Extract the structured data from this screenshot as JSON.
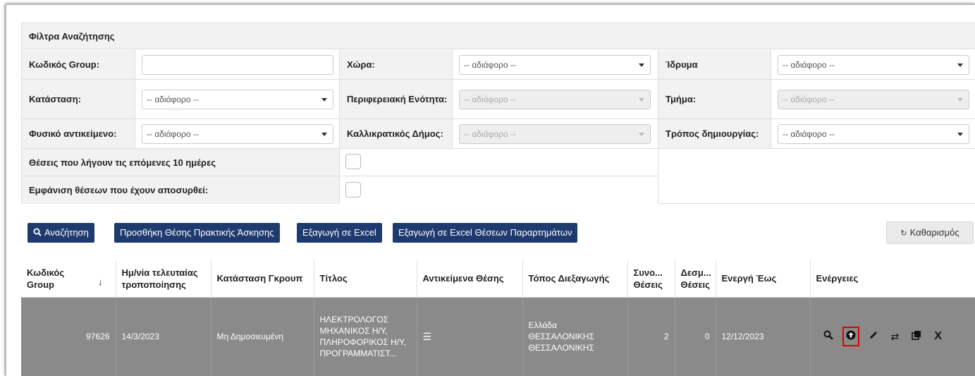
{
  "filters": {
    "title": "Φίλτρα Αναζήτησης",
    "group_code_label": "Κωδικός Group:",
    "group_code_value": "",
    "country_label": "Χώρα:",
    "country_value": "-- αδιάφορο --",
    "institution_label": "Ίδρυμα",
    "institution_value": "-- αδιάφορο --",
    "status_label": "Κατάσταση:",
    "status_value": "-- αδιάφορο --",
    "region_label": "Περιφερειακή Ενότητα:",
    "region_value": "-- αδιάφορο --",
    "department_label": "Τμήμα:",
    "department_value": "-- αδιάφορο --",
    "physical_object_label": "Φυσικό αντικείμενο:",
    "physical_object_value": "-- αδιάφορο --",
    "municipality_label": "Καλλικρατικός Δήμος:",
    "municipality_value": "-- αδιάφορο --",
    "creation_mode_label": "Τρόπος δημιουργίας:",
    "creation_mode_value": "-- αδιάφορο --",
    "expiring_label": "Θέσεις που λήγουν τις επόμενες 10 ημέρες",
    "withdrawn_label": "Εμφάνιση θέσεων που έχουν αποσυρθεί:"
  },
  "buttons": {
    "search": "Αναζήτηση",
    "add_position": "Προσθήκη Θέσης Πρακτικής Άσκησης",
    "export_excel": "Εξαγωγή σε Excel",
    "export_excel_branches": "Εξαγωγή σε Excel Θέσεων Παραρτημάτων",
    "clear": "Καθαρισμός"
  },
  "table": {
    "headers": {
      "group_code": "Κωδικός Group",
      "last_modified": "Ημ/νία τελευταίας τροποποίησης",
      "group_status": "Κατάσταση Γκρουπ",
      "title": "Τίτλος",
      "objects": "Αντικείμενα Θέσης",
      "location": "Τόπος Διεξαγωγής",
      "total_positions": "Συνο... Θέσεις",
      "bound_positions": "Δεσμ... Θέσεις",
      "active_until": "Ενεργή Έως",
      "actions": "Ενέργειες"
    },
    "rows": [
      {
        "group_code": "97626",
        "last_modified": "14/3/2023",
        "group_status": "Μη Δημοσιευμένη",
        "title": "ΗΛΕΚΤΡΟΛΟΓΟΣ ΜΗΧΑΝΙΚΟΣ Η/Υ, ΠΛΗΡΟΦΟΡΙΚΟΣ Η/Υ, ΠΡΟΓΡΑΜΜΑΤΙΣΤ...",
        "location": "Ελλάδα ΘΕΣΣΑΛΟΝΙΚΗΣ ΘΕΣΣΑΛΟΝΙΚΗΣ",
        "total_positions": "2",
        "bound_positions": "0",
        "active_until": "12/12/2023"
      }
    ]
  },
  "colors": {
    "primary_button": "#1f3a6e",
    "row_background": "#8a8a8a",
    "highlight": "#e00000"
  }
}
